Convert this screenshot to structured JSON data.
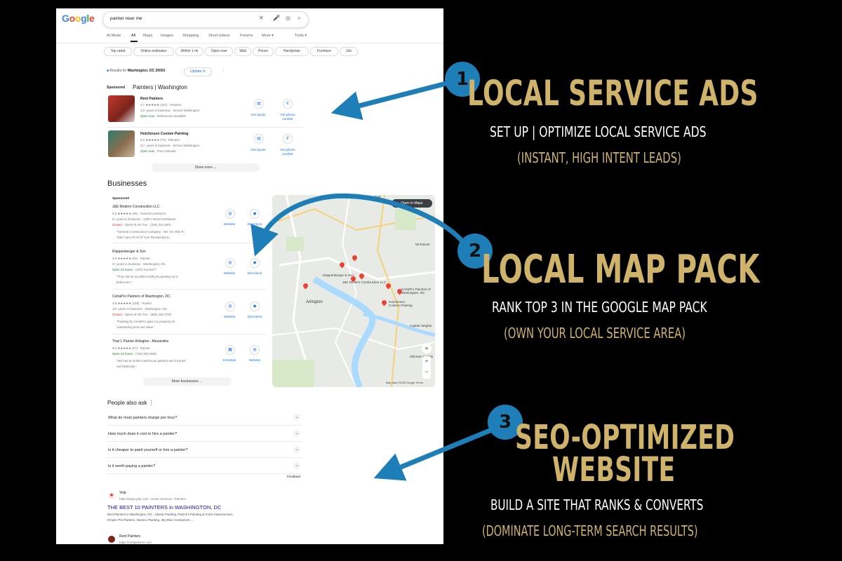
{
  "google": {
    "logo": "Google",
    "logo_colors": [
      "#4285F4",
      "#EA4335",
      "#FBBC05",
      "#4285F4",
      "#34A853",
      "#EA4335"
    ],
    "search_query": "painter near me",
    "icons": [
      "close-icon",
      "mic-icon",
      "lens-icon",
      "search-icon"
    ],
    "tabs": [
      "AI Mode",
      "All",
      "Maps",
      "Images",
      "Shopping",
      "Short videos",
      "Forums",
      "More ▾"
    ],
    "active_tab": "All",
    "tools_label": "Tools ▾",
    "chips": [
      "Top rated",
      "Online estimates",
      "Within 1 mi",
      "Open now",
      "Wall",
      "Prices",
      "Handyman",
      "Furniture",
      "Job"
    ]
  },
  "location": {
    "prefix": "Results for",
    "place": "Washington, DC 20003",
    "update_label": "Update ⟳"
  },
  "lsa": {
    "sponsored": "Sponsored",
    "heading": "Painters | Washington",
    "listings": [
      {
        "name": "Rent Painters",
        "rating_line": "4.7 ★★★★★ (167) · Painters",
        "years": "13+ years in business · Serves Washington",
        "status": "Open now",
        "extra": " · References available",
        "quote": "Get Quote",
        "call": "Get phone number"
      },
      {
        "name": "Hutchinson Custom Painting",
        "rating_line": "5.0 ★★★★★ (73) · Painters",
        "years": "41+ years in business · Serves Washington",
        "status": "Open now",
        "extra": " · Free estimate",
        "quote": "Get Quote",
        "call": "Get phone number"
      }
    ],
    "show_more": "Show more ⌄"
  },
  "businesses": {
    "heading": "Businesses",
    "sponsored": "Sponsored",
    "items": [
      {
        "name": "J&E Modern Construction LLC",
        "rating": "5.0 ★★★★★ (29) · General contractor",
        "years": "5+ years in business · 1330 I Street Northwest",
        "status": "Closed",
        "status_rest": " · Opens 8 AM Tue · (202) 321-8301",
        "desc1": "\"General Construction Company - We Are Able To",
        "desc2": "Take Care Of All Of Your Residential &...",
        "btn1": "Website",
        "btn2": "Directions"
      },
      {
        "name": "Klappenberger & Son",
        "rating": "4.9 ★★★★★ (15) · Painter",
        "years": "3+ years in business · Washington, DC",
        "status": "Open 24 hours",
        "status_rest": " · (240) 912-6477",
        "desc1": "\"They did an excellent swift job painting my 3",
        "desc2": "bedrooms.\"",
        "btn1": "Website",
        "btn2": "Directions"
      },
      {
        "name": "CertaPro Painters of Washington, DC",
        "rating": "4.8 ★★★★★ (158) · Painter",
        "years": "13+ years in business · Washington, DC",
        "status": "Closed",
        "status_rest": " · Opens 8 AM Tue · (800) 462-3752",
        "desc1": "\"Painting by CertaPro gave my property an",
        "desc2": "outstanding look and value.\"",
        "btn1": "Website",
        "btn2": "Directions"
      },
      {
        "name": "That 1 Painter Arlington - Alexandria",
        "rating": "5.0 ★★★★★ (67) · Painter",
        "years": "",
        "status": "Open 24 hours",
        "status_rest": " · (703) 902-0040",
        "desc1": "\"We had an entire townhouse painted and it turned",
        "desc2": "out flawlessly.\"",
        "btn1": "Schedule",
        "btn2": "Website"
      }
    ],
    "more": "More businesses →"
  },
  "map": {
    "open_label": "Open in Maps",
    "labels": [
      "Takoma Park",
      "Arlington",
      "Klappenberger & Son",
      "J&E Modern Construction LLC",
      "CertaPro Painters of Washington, DC",
      "Hutchinson Custom Painting",
      "Capital Heights",
      "Hillcrest Heights",
      "Mt Rainier",
      "Map data ©2025 Google",
      "Terms"
    ]
  },
  "paa": {
    "heading": "People also ask",
    "questions": [
      "What do most painters charge per hour?",
      "How much does it cost to hire a painter?",
      "Is it cheaper to paint yourself or hire a painter?",
      "Is it worth paying a painter?"
    ],
    "feedback": "Feedback"
  },
  "organic": {
    "site": "Yelp",
    "url": "https://www.yelp.com › Home Services › Painters",
    "title": "THE BEST 10 PAINTERS in WASHINGTON, DC",
    "snippet1": "Best Painters in Washington, DC - Liberty Painting, Patrick's Painting & Home Improvement,",
    "snippet2": "Empire Pro Painters, Darinco Painting, Sky Blue Contractors, ...",
    "site2": "Rent Painters",
    "url2": "https://rentpainters.com"
  },
  "annotations": [
    {
      "num": "1",
      "title": "LOCAL SERVICE ADS",
      "subtitle": "SET UP | OPTIMIZE LOCAL SERVICE ADS",
      "paren": "(INSTANT, HIGH INTENT LEADS)"
    },
    {
      "num": "2",
      "title": "LOCAL MAP PACK",
      "subtitle": "RANK TOP 3 IN THE GOOGLE MAP PACK",
      "paren": "(OWN YOUR LOCAL SERVICE AREA)"
    },
    {
      "num": "3",
      "title1": "SEO-OPTIMIZED",
      "title2": "WEBSITE",
      "subtitle": "BUILD A SITE THAT RANKS & CONVERTS",
      "paren": "(DOMINATE LONG-TERM SEARCH RESULTS)"
    }
  ],
  "colors": {
    "accent_gold": "#cfb36a",
    "arrow_blue": "#1e7fb8",
    "link_blue": "#1a0dab",
    "google_blue": "#1a73e8"
  }
}
